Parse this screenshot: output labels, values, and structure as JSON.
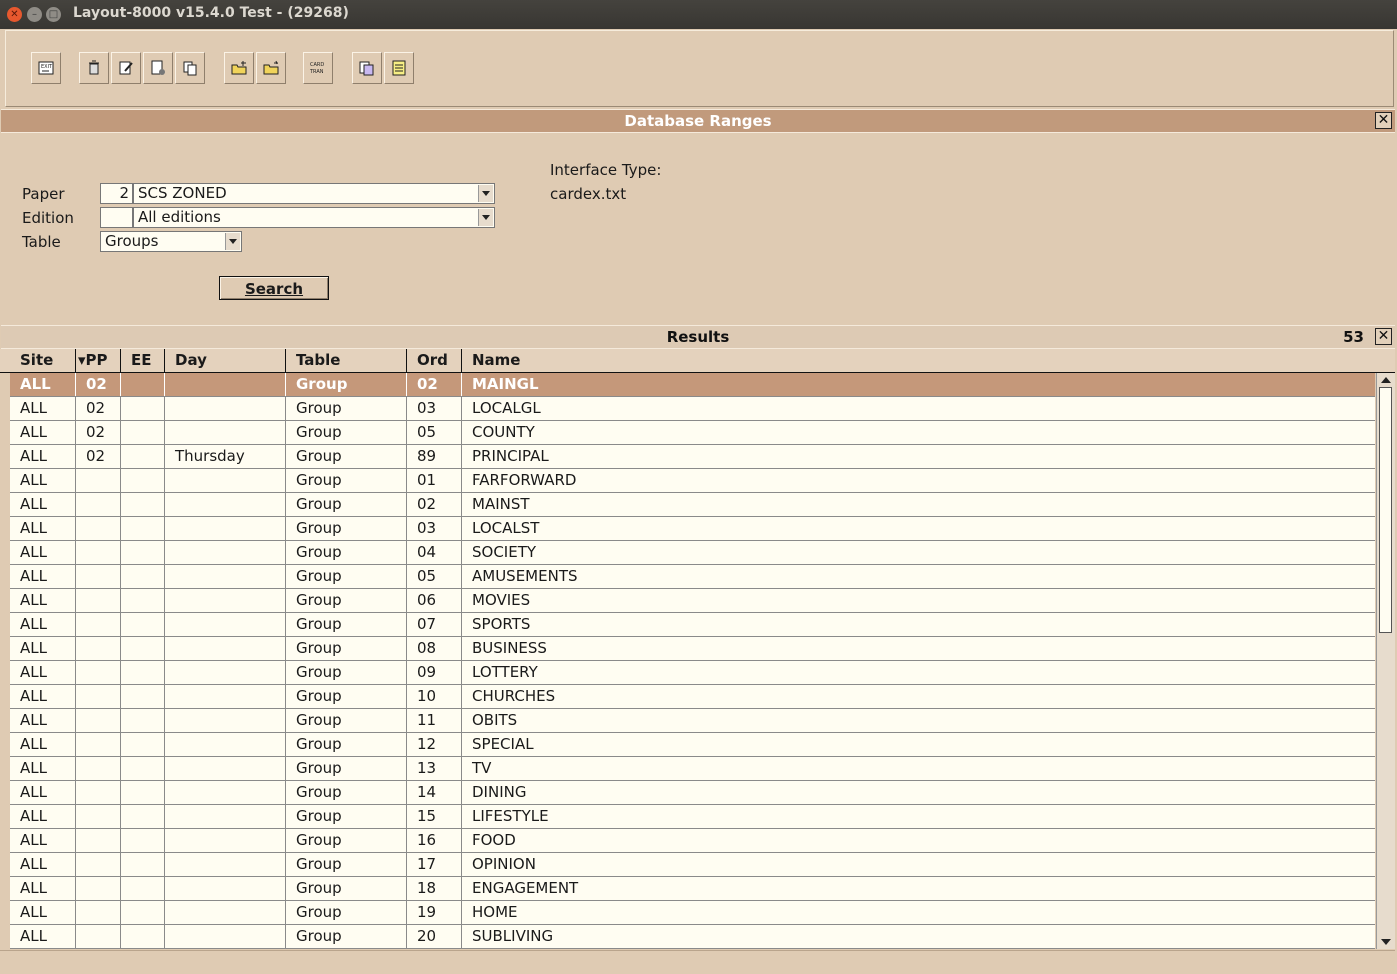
{
  "window": {
    "title": "Layout-8000 v15.4.0 Test - (29268)"
  },
  "toolbar": {
    "groups": [
      [
        "export-icon"
      ],
      [
        "trash-icon",
        "edit-icon",
        "new-page-icon",
        "copy-icon"
      ],
      [
        "folder-add-icon",
        "folder-new-icon"
      ],
      [
        "card-tran-icon"
      ],
      [
        "duplicate-icon",
        "notes-icon"
      ]
    ],
    "card_tran_label": "CARD TRAN"
  },
  "db_ranges": {
    "title": "Database Ranges",
    "paper_label": "Paper",
    "paper_number": "2",
    "paper_value": "SCS ZONED",
    "edition_label": "Edition",
    "edition_number": "",
    "edition_value": "All editions",
    "table_label": "Table",
    "table_value": "Groups",
    "search_label": "Search",
    "interface_type_label": "Interface Type:",
    "interface_type_value": "cardex.txt",
    "close": "✕"
  },
  "results": {
    "title": "Results",
    "count": "53",
    "close": "✕",
    "columns": [
      "Site",
      "▾PP",
      "EE",
      "Day",
      "Table",
      "Ord",
      "Name"
    ],
    "rows": [
      [
        "ALL",
        "02",
        "",
        "",
        "Group",
        "02",
        "MAINGL"
      ],
      [
        "ALL",
        "02",
        "",
        "",
        "Group",
        "03",
        "LOCALGL"
      ],
      [
        "ALL",
        "02",
        "",
        "",
        "Group",
        "05",
        "COUNTY"
      ],
      [
        "ALL",
        "02",
        "",
        "Thursday",
        "Group",
        "89",
        "PRINCIPAL"
      ],
      [
        "ALL",
        "",
        "",
        "",
        "Group",
        "01",
        "FARFORWARD"
      ],
      [
        "ALL",
        "",
        "",
        "",
        "Group",
        "02",
        "MAINST"
      ],
      [
        "ALL",
        "",
        "",
        "",
        "Group",
        "03",
        "LOCALST"
      ],
      [
        "ALL",
        "",
        "",
        "",
        "Group",
        "04",
        "SOCIETY"
      ],
      [
        "ALL",
        "",
        "",
        "",
        "Group",
        "05",
        "AMUSEMENTS"
      ],
      [
        "ALL",
        "",
        "",
        "",
        "Group",
        "06",
        "MOVIES"
      ],
      [
        "ALL",
        "",
        "",
        "",
        "Group",
        "07",
        "SPORTS"
      ],
      [
        "ALL",
        "",
        "",
        "",
        "Group",
        "08",
        "BUSINESS"
      ],
      [
        "ALL",
        "",
        "",
        "",
        "Group",
        "09",
        "LOTTERY"
      ],
      [
        "ALL",
        "",
        "",
        "",
        "Group",
        "10",
        "CHURCHES"
      ],
      [
        "ALL",
        "",
        "",
        "",
        "Group",
        "11",
        "OBITS"
      ],
      [
        "ALL",
        "",
        "",
        "",
        "Group",
        "12",
        "SPECIAL"
      ],
      [
        "ALL",
        "",
        "",
        "",
        "Group",
        "13",
        "TV"
      ],
      [
        "ALL",
        "",
        "",
        "",
        "Group",
        "14",
        "DINING"
      ],
      [
        "ALL",
        "",
        "",
        "",
        "Group",
        "15",
        "LIFESTYLE"
      ],
      [
        "ALL",
        "",
        "",
        "",
        "Group",
        "16",
        "FOOD"
      ],
      [
        "ALL",
        "",
        "",
        "",
        "Group",
        "17",
        "OPINION"
      ],
      [
        "ALL",
        "",
        "",
        "",
        "Group",
        "18",
        "ENGAGEMENT"
      ],
      [
        "ALL",
        "",
        "",
        "",
        "Group",
        "19",
        "HOME"
      ],
      [
        "ALL",
        "",
        "",
        "",
        "Group",
        "20",
        "SUBLIVING"
      ]
    ],
    "selected_row": 0
  },
  "colors": {
    "accent": "#c19a7c",
    "background": "#dfcbb3",
    "field": "#fffdf2"
  }
}
